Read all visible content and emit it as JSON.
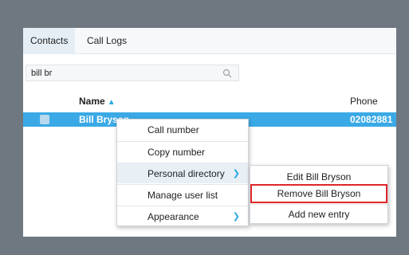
{
  "tabs": [
    {
      "label": "Contacts",
      "active": true
    },
    {
      "label": "Call Logs",
      "active": false
    }
  ],
  "search": {
    "value": "bill br",
    "icon": "search-icon"
  },
  "table": {
    "headers": {
      "name": "Name",
      "phone": "Phone"
    },
    "sort_icon": "caret-up-icon",
    "rows": [
      {
        "name": "Bill Bryson",
        "phone": "02082881",
        "selected": true
      }
    ]
  },
  "context_menu": {
    "items": [
      {
        "label": "Call number"
      },
      {
        "label": "Copy number"
      },
      {
        "label": "Personal directory",
        "submenu": true
      },
      {
        "label": "Manage user list"
      },
      {
        "label": "Appearance",
        "submenu": true
      }
    ]
  },
  "submenu": {
    "items": [
      {
        "label": "Edit Bill Bryson"
      },
      {
        "label": "Remove Bill Bryson",
        "highlighted": true
      },
      {
        "label": "Add new entry"
      }
    ]
  },
  "colors": {
    "accent": "#3aa9e5",
    "highlight_border": "#e0262b",
    "backdrop": "#6f7780"
  }
}
